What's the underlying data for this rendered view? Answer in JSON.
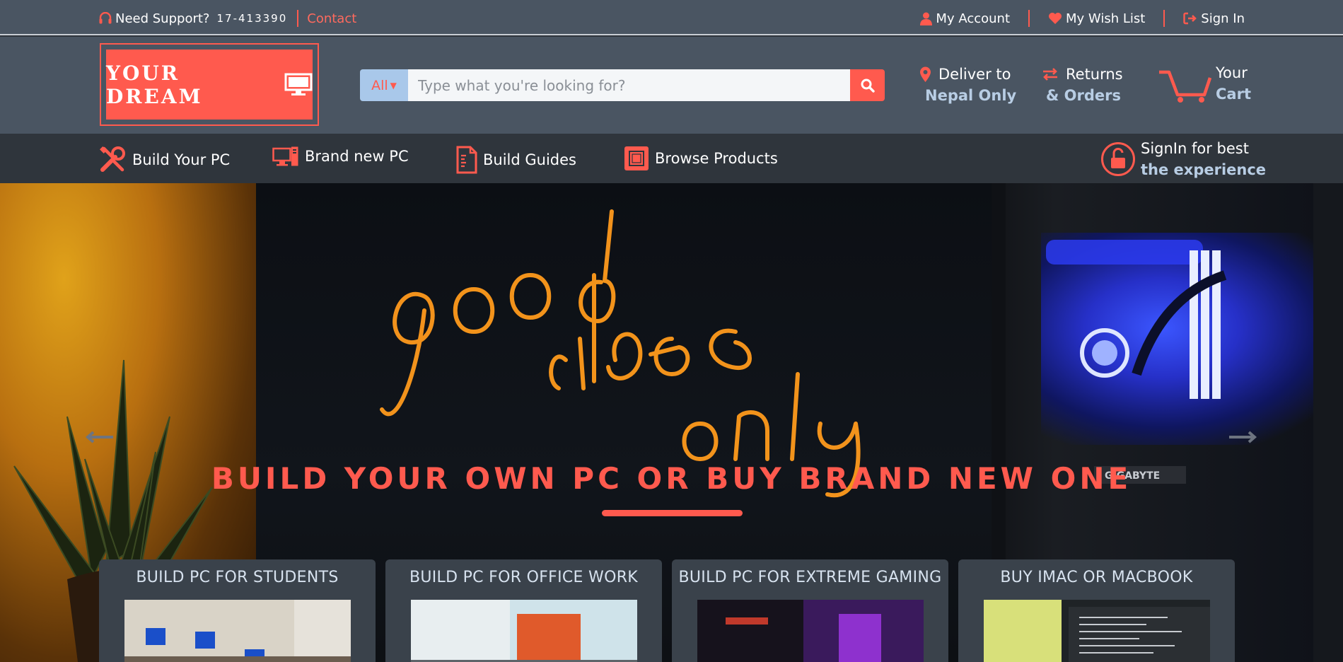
{
  "topbar": {
    "support_label": "Need Support?",
    "phone": "17-413390",
    "contact_label": "Contact",
    "my_account_label": "My Account",
    "wish_list_label": "My Wish List",
    "sign_in_label": "Sign In"
  },
  "header": {
    "logo_text": "YOUR DREAM",
    "search": {
      "category": "All",
      "placeholder": "Type what you're looking for?"
    },
    "deliver": {
      "line1": "Deliver to",
      "line2": "Nepal Only"
    },
    "returns": {
      "line1": "Returns",
      "line2": "& Orders"
    },
    "cart": {
      "line1": "Your",
      "line2": "Cart"
    }
  },
  "nav": {
    "items": [
      {
        "label": "Build Your PC"
      },
      {
        "label": "Brand new PC"
      },
      {
        "label": "Build Guides"
      },
      {
        "label": "Browse Products"
      }
    ],
    "signin_best": {
      "line1": "SignIn for best",
      "line2": "the experience"
    }
  },
  "hero": {
    "neon_text": [
      "good",
      "vibes",
      "only"
    ],
    "title": "BUILD YOUR OWN PC OR BUY BRAND NEW ONE",
    "case_brand": "GIGABYTE"
  },
  "cards": [
    {
      "title": "BUILD PC FOR STUDENTS"
    },
    {
      "title": "BUILD PC FOR OFFICE WORK"
    },
    {
      "title": "BUILD PC FOR EXTREME GAMING"
    },
    {
      "title": "BUY IMAC OR MACBOOK"
    }
  ],
  "colors": {
    "accent": "#ff5a4e",
    "header_bg": "#4a5562",
    "nav_bg": "#2f353c",
    "highlight_text": "#b8cde4"
  }
}
